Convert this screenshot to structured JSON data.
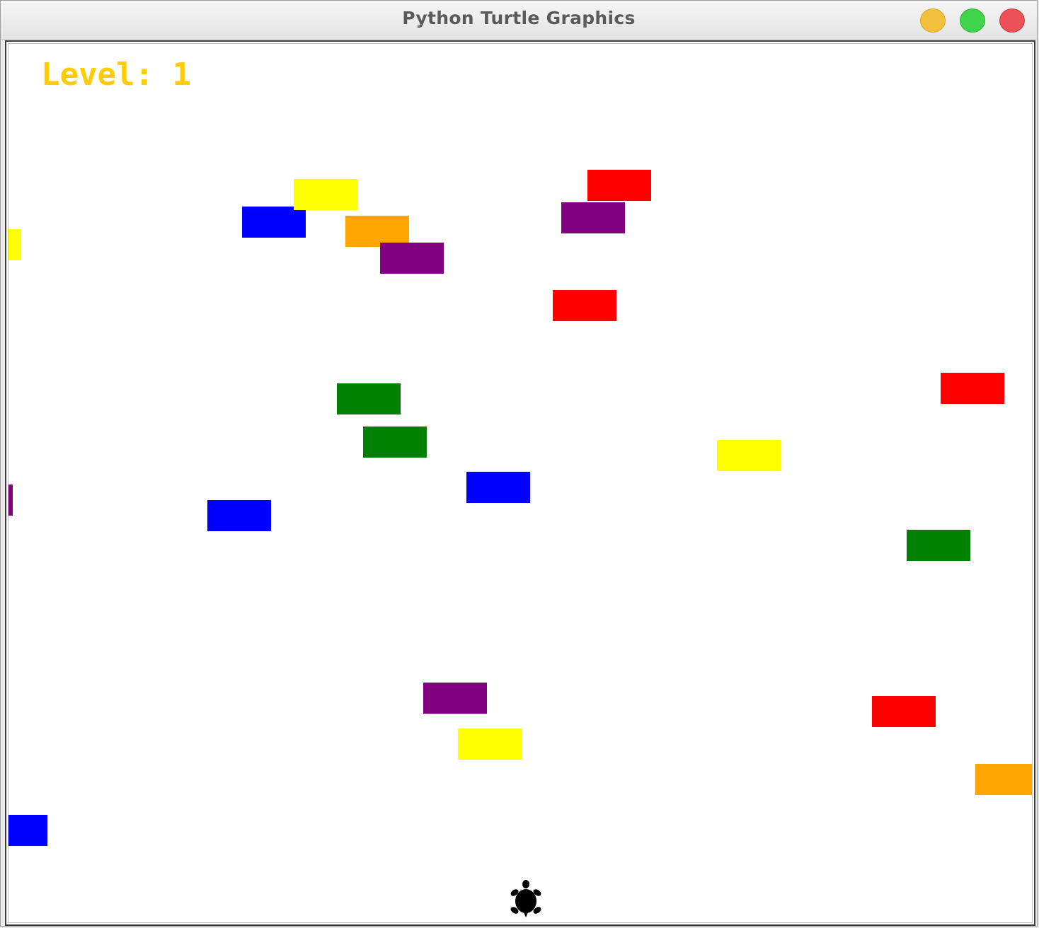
{
  "window": {
    "title": "Python Turtle Graphics"
  },
  "hud": {
    "level_label": "Level:",
    "level_value": "1"
  },
  "colors": {
    "level_text": "#ffcc00",
    "canvas_bg": "#ffffff",
    "red": "#ff0000",
    "yellow": "#ffff00",
    "blue": "#0000ff",
    "orange": "#ffa500",
    "purple": "#800080",
    "green": "#008000"
  },
  "cars": [
    {
      "color": "yellow"
    },
    {
      "color": "red"
    },
    {
      "color": "blue"
    },
    {
      "color": "purple"
    },
    {
      "color": "orange"
    },
    {
      "color": "yellow"
    },
    {
      "color": "purple"
    },
    {
      "color": "red"
    },
    {
      "color": "red"
    },
    {
      "color": "green"
    },
    {
      "color": "green"
    },
    {
      "color": "yellow"
    },
    {
      "color": "blue"
    },
    {
      "color": "purple"
    },
    {
      "color": "blue"
    },
    {
      "color": "green"
    },
    {
      "color": "purple"
    },
    {
      "color": "red"
    },
    {
      "color": "yellow"
    },
    {
      "color": "orange"
    },
    {
      "color": "blue"
    }
  ],
  "player": {
    "icon": "turtle-icon"
  }
}
